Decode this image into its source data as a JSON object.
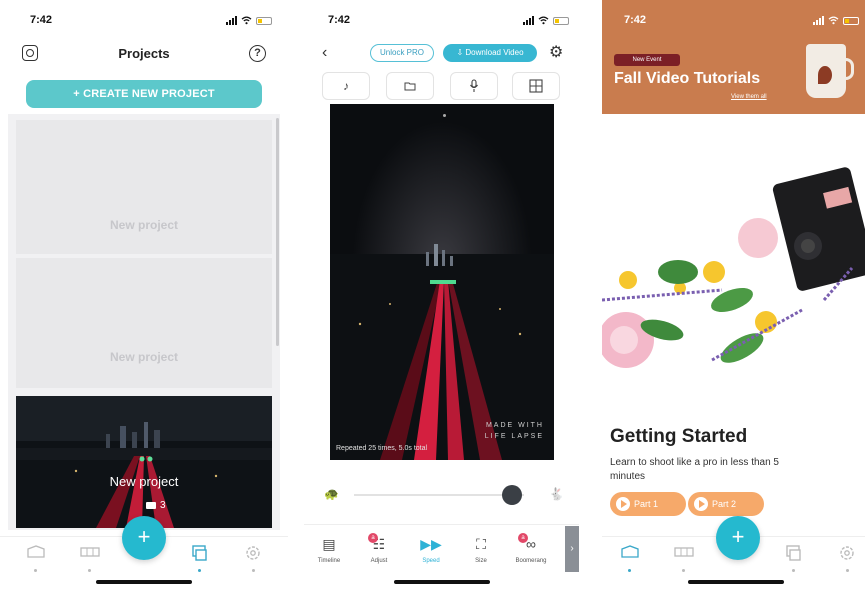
{
  "colors": {
    "accent": "#25b9cf",
    "create_button": "#5cc8cb",
    "banner": "#c97c4e",
    "part_button": "#f6a96a",
    "badge": "#e24868"
  },
  "screen1": {
    "time": "7:42",
    "title": "Projects",
    "create_button": "+ CREATE NEW PROJECT",
    "projects": [
      {
        "label": "New project"
      },
      {
        "label": "New project"
      },
      {
        "label": "New project",
        "photo_count": "3"
      }
    ],
    "tabs": [
      "reel-icon",
      "storyboard-icon",
      "projects-icon",
      "settings-icon"
    ],
    "fab": "+"
  },
  "screen2": {
    "time": "7:42",
    "unlock_label": "Unlock PRO",
    "download_label": "⇩ Download Video",
    "tools": [
      "music-icon",
      "folder-icon",
      "mic-icon",
      "grid-icon"
    ],
    "watermark_line1": "MADE WITH",
    "watermark_line2": "LIFE LAPSE",
    "repeat_text": "Repeated 25 times, 5.0s total",
    "edit_items": [
      {
        "label": "Timeline",
        "icon": "▤"
      },
      {
        "label": "Adjust",
        "icon": "☷",
        "badge": "a"
      },
      {
        "label": "Speed",
        "icon": "▶▶"
      },
      {
        "label": "Size",
        "icon": "⛶"
      },
      {
        "label": "Boomerang",
        "icon": "∞",
        "badge": "a"
      }
    ]
  },
  "screen3": {
    "time": "7:42",
    "event_tag": "New Event",
    "banner_title": "Fall Video Tutorials",
    "banner_link": "View them all",
    "heading": "Getting Started",
    "description": "Learn to shoot like a pro in less than 5 minutes",
    "part1": "Part 1",
    "part2": "Part 2",
    "fab": "+"
  }
}
